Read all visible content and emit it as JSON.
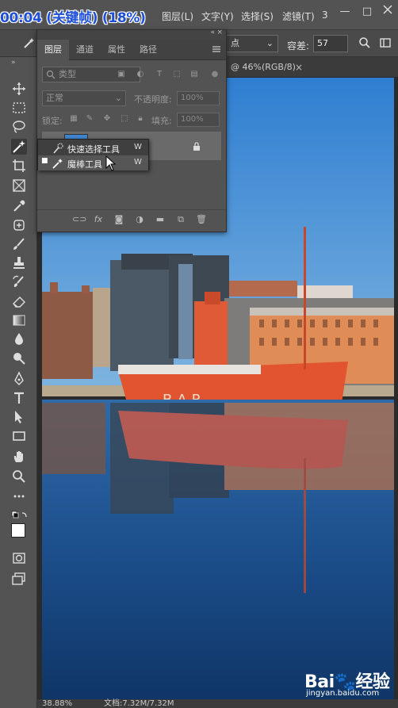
{
  "overlay_timestamp": "00:04 (关键帧) (18%)",
  "menubar": {
    "items": [
      "图层(L)",
      "文字(Y)",
      "选择(S)",
      "滤镜(T)",
      "3"
    ],
    "window_controls": [
      "—",
      "□"
    ]
  },
  "options": {
    "sample_select": "点",
    "tolerance_label": "容差:",
    "tolerance_value": "57"
  },
  "document": {
    "tab_title": "@ 46%(RGB/8)",
    "close": "×"
  },
  "layers_panel": {
    "tabs": [
      "图层",
      "通道",
      "属性",
      "路径"
    ],
    "menu_icon": "hamburger-icon",
    "search_placeholder": "类型",
    "blend_mode": "正常",
    "opacity_label": "不透明度:",
    "opacity_value": "100%",
    "lock_label": "锁定:",
    "fill_label": "填充:",
    "fill_value": "100%",
    "bottom_icons": [
      "link-icon",
      "fx-icon",
      "mask-icon",
      "adjustment-icon",
      "folder-icon",
      "new-layer-icon",
      "trash-icon"
    ]
  },
  "tool_flyout": {
    "items": [
      {
        "label": "快速选择工具",
        "key": "W",
        "selected": false
      },
      {
        "label": "魔棒工具",
        "key": "W",
        "selected": true
      }
    ]
  },
  "status_bar": {
    "zoom": "38.88%",
    "doc_info": "文档:7.32M/7.32M"
  },
  "watermark": {
    "logo": "Bai🐾经验",
    "url": "jingyan.baidu.com"
  },
  "colors": {
    "panel_bg": "#535353",
    "toolbar_bg": "#535353",
    "sky": "#3f86d0",
    "boat": "#e2542f",
    "water": "#1d4f8c"
  }
}
